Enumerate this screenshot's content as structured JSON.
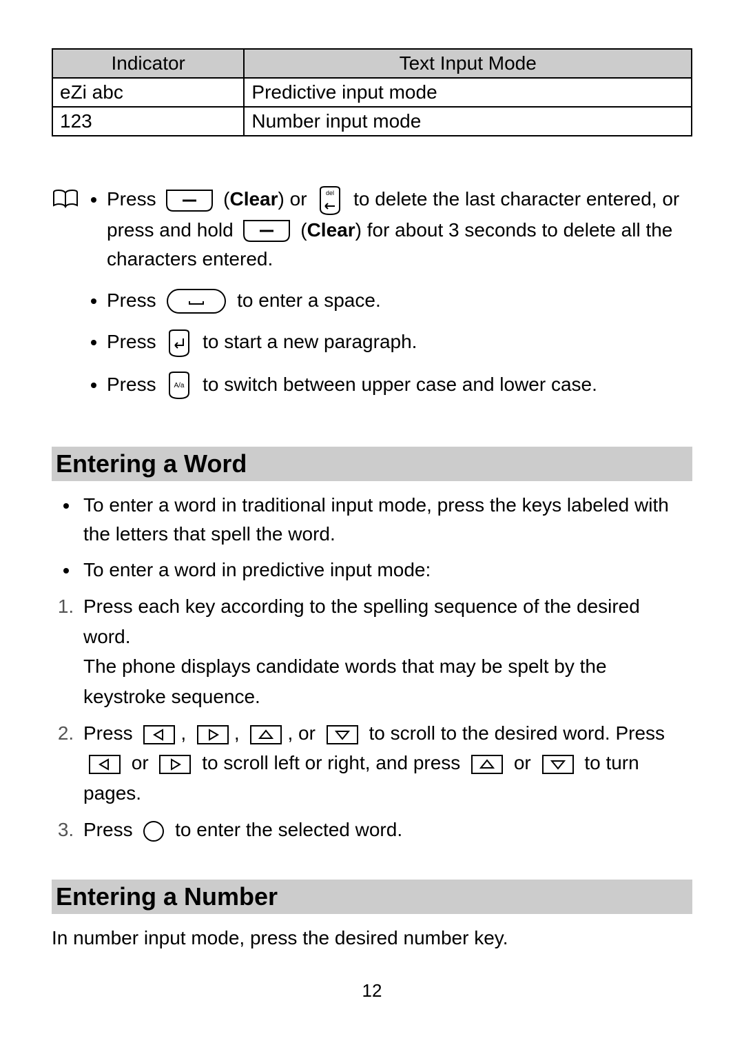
{
  "table": {
    "headers": [
      "Indicator",
      "Text Input Mode"
    ],
    "rows": [
      {
        "indicator": "eZi abc",
        "mode": "Predictive input mode"
      },
      {
        "indicator": "123",
        "mode": "Number input mode"
      }
    ]
  },
  "notes": {
    "item1": {
      "press": "Press ",
      "clear1": " (",
      "clearBold1": "Clear",
      "or": ") or ",
      "after_del": " to delete the last character entered, or press and hold ",
      "clear2": " (",
      "clearBold2": "Clear",
      "after_clear2": ") for about 3 seconds to delete all the characters entered."
    },
    "item2": {
      "press": "Press ",
      "after": " to enter a space."
    },
    "item3": {
      "press": "Press ",
      "after": " to start a new paragraph."
    },
    "item4": {
      "press": "Press ",
      "after": " to switch between upper case and lower case."
    }
  },
  "sections": {
    "enteringWord": {
      "heading": "Entering a Word",
      "bullets": [
        "To enter a word in traditional input mode, press the keys labeled with the letters that spell the word.",
        "To enter a word in predictive input mode:"
      ],
      "steps": {
        "s1a": "Press each key according to the spelling sequence of the desired word.",
        "s1b": "The phone displays candidate words that may be spelt by the keystroke sequence.",
        "s2": {
          "press": "Press ",
          "c1": ", ",
          "c2": ", ",
          "c3": ", or ",
          "afterArrows": " to scroll to the desired word. Press ",
          "or1": " or ",
          "afterLR": " to scroll left or right, and press ",
          "or2": " or ",
          "afterUD": " to turn pages."
        },
        "s3": {
          "press": "Press ",
          "after": " to enter the selected word."
        }
      }
    },
    "enteringNumber": {
      "heading": "Entering a Number",
      "body": "In number input mode, press the desired number key."
    }
  },
  "pageNumber": "12"
}
